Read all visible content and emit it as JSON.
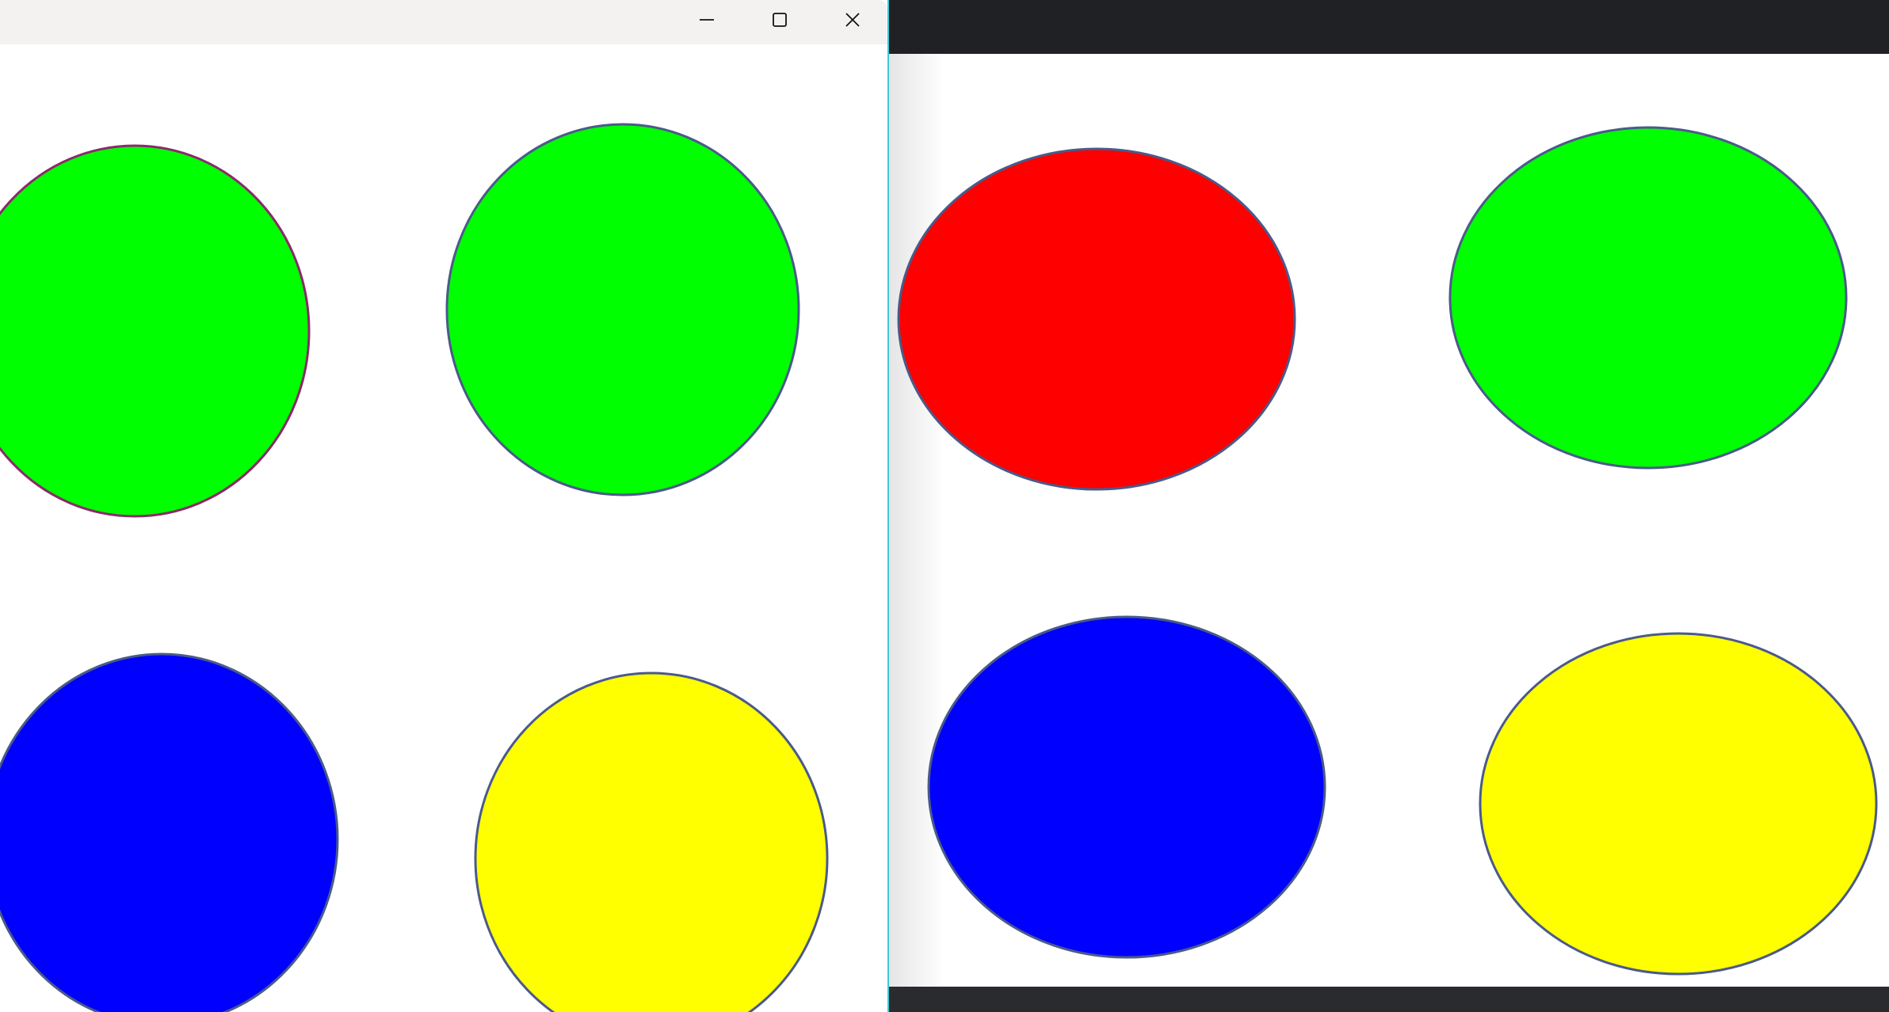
{
  "left_window": {
    "controls": {
      "minimize_icon": "minimize-icon",
      "maximize_icon": "maximize-icon",
      "close_icon": "close-icon"
    },
    "accent_border": "#3fc6d6",
    "titlebar_color": "#f4f2f0"
  },
  "colors": {
    "circle_1": "#00ff00",
    "circle_2": "#00ff00",
    "circle_3": "#0000ff",
    "circle_4": "#ffff00",
    "circle_5": "#ff0000",
    "circle_6": "#00ff00",
    "circle_7": "#0000ff",
    "circle_8": "#ffff00",
    "outline": "#4a5a8a",
    "outline_alt": "#8a2a6a"
  }
}
